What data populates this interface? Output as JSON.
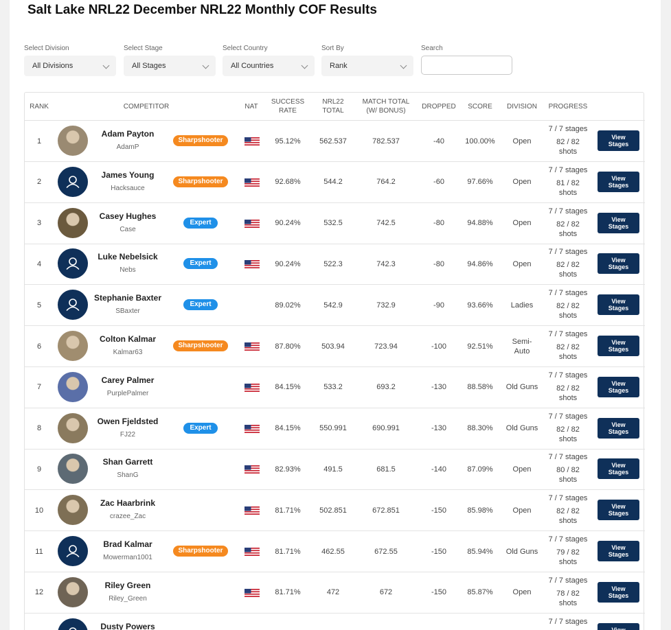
{
  "page_title": "Salt Lake NRL22 December NRL22 Monthly COF Results",
  "filters": {
    "division": {
      "label": "Select Division",
      "value": "All Divisions"
    },
    "stage": {
      "label": "Select Stage",
      "value": "All Stages"
    },
    "country": {
      "label": "Select Country",
      "value": "All Countries"
    },
    "sort": {
      "label": "Sort By",
      "value": "Rank"
    },
    "search": {
      "label": "Search",
      "placeholder": ""
    }
  },
  "columns": {
    "rank": "RANK",
    "competitor": "COMPETITOR",
    "nat": "NAT",
    "success_rate_1": "SUCCESS",
    "success_rate_2": "RATE",
    "nrl22_total_1": "NRL22",
    "nrl22_total_2": "TOTAL",
    "match_total_1": "MATCH TOTAL",
    "match_total_2": "(W/ BONUS)",
    "dropped": "DROPPED",
    "score": "SCORE",
    "division": "DIVISION",
    "progress": "PROGRESS"
  },
  "view_button_label": "View Stages",
  "rows": [
    {
      "rank": "1",
      "name": "Adam Payton",
      "user": "AdamP",
      "badge": "Sharpshooter",
      "badge_type": "sharp",
      "flag": true,
      "success": "95.12%",
      "nrl22": "562.537",
      "match": "782.537",
      "dropped": "-40",
      "score": "100.00%",
      "division": "Open",
      "stages": "7 / 7 stages",
      "shots": "82 / 82 shots",
      "avatar": "photo",
      "avatar_color": "#9a8a72"
    },
    {
      "rank": "2",
      "name": "James Young",
      "user": "Hacksauce",
      "badge": "Sharpshooter",
      "badge_type": "sharp",
      "flag": true,
      "success": "92.68%",
      "nrl22": "544.2",
      "match": "764.2",
      "dropped": "-60",
      "score": "97.66%",
      "division": "Open",
      "stages": "7 / 7 stages",
      "shots": "81 / 82 shots",
      "avatar": "default",
      "avatar_color": "#0f3059"
    },
    {
      "rank": "3",
      "name": "Casey Hughes",
      "user": "Case",
      "badge": "Expert",
      "badge_type": "expert",
      "flag": true,
      "success": "90.24%",
      "nrl22": "532.5",
      "match": "742.5",
      "dropped": "-80",
      "score": "94.88%",
      "division": "Open",
      "stages": "7 / 7 stages",
      "shots": "82 / 82 shots",
      "avatar": "photo",
      "avatar_color": "#6b5a3e"
    },
    {
      "rank": "4",
      "name": "Luke Nebelsick",
      "user": "Nebs",
      "badge": "Expert",
      "badge_type": "expert",
      "flag": true,
      "success": "90.24%",
      "nrl22": "522.3",
      "match": "742.3",
      "dropped": "-80",
      "score": "94.86%",
      "division": "Open",
      "stages": "7 / 7 stages",
      "shots": "82 / 82 shots",
      "avatar": "default",
      "avatar_color": "#0f3059"
    },
    {
      "rank": "5",
      "name": "Stephanie Baxter",
      "user": "SBaxter",
      "badge": "Expert",
      "badge_type": "expert",
      "flag": false,
      "success": "89.02%",
      "nrl22": "542.9",
      "match": "732.9",
      "dropped": "-90",
      "score": "93.66%",
      "division": "Ladies",
      "stages": "7 / 7 stages",
      "shots": "82 / 82 shots",
      "avatar": "default",
      "avatar_color": "#0f3059"
    },
    {
      "rank": "6",
      "name": "Colton Kalmar",
      "user": "Kalmar63",
      "badge": "Sharpshooter",
      "badge_type": "sharp",
      "flag": true,
      "success": "87.80%",
      "nrl22": "503.94",
      "match": "723.94",
      "dropped": "-100",
      "score": "92.51%",
      "division": "Semi-Auto",
      "stages": "7 / 7 stages",
      "shots": "82 / 82 shots",
      "avatar": "photo",
      "avatar_color": "#a08d6f"
    },
    {
      "rank": "7",
      "name": "Carey Palmer",
      "user": "PurplePalmer",
      "badge": "",
      "badge_type": "none",
      "flag": true,
      "success": "84.15%",
      "nrl22": "533.2",
      "match": "693.2",
      "dropped": "-130",
      "score": "88.58%",
      "division": "Old Guns",
      "stages": "7 / 7 stages",
      "shots": "82 / 82 shots",
      "avatar": "photo",
      "avatar_color": "#5a6fa8"
    },
    {
      "rank": "8",
      "name": "Owen Fjeldsted",
      "user": "FJ22",
      "badge": "Expert",
      "badge_type": "expert",
      "flag": true,
      "success": "84.15%",
      "nrl22": "550.991",
      "match": "690.991",
      "dropped": "-130",
      "score": "88.30%",
      "division": "Old Guns",
      "stages": "7 / 7 stages",
      "shots": "82 / 82 shots",
      "avatar": "photo",
      "avatar_color": "#8a7a5e"
    },
    {
      "rank": "9",
      "name": "Shan Garrett",
      "user": "ShanG",
      "badge": "",
      "badge_type": "none",
      "flag": true,
      "success": "82.93%",
      "nrl22": "491.5",
      "match": "681.5",
      "dropped": "-140",
      "score": "87.09%",
      "division": "Open",
      "stages": "7 / 7 stages",
      "shots": "80 / 82 shots",
      "avatar": "photo",
      "avatar_color": "#5d6a74"
    },
    {
      "rank": "10",
      "name": "Zac Haarbrink",
      "user": "crazee_Zac",
      "badge": "",
      "badge_type": "none",
      "flag": true,
      "success": "81.71%",
      "nrl22": "502.851",
      "match": "672.851",
      "dropped": "-150",
      "score": "85.98%",
      "division": "Open",
      "stages": "7 / 7 stages",
      "shots": "82 / 82 shots",
      "avatar": "photo",
      "avatar_color": "#7e6f55"
    },
    {
      "rank": "11",
      "name": "Brad Kalmar",
      "user": "Mowerman1001",
      "badge": "Sharpshooter",
      "badge_type": "sharp",
      "flag": true,
      "success": "81.71%",
      "nrl22": "462.55",
      "match": "672.55",
      "dropped": "-150",
      "score": "85.94%",
      "division": "Old Guns",
      "stages": "7 / 7 stages",
      "shots": "79 / 82 shots",
      "avatar": "default",
      "avatar_color": "#0f3059"
    },
    {
      "rank": "12",
      "name": "Riley Green",
      "user": "Riley_Green",
      "badge": "",
      "badge_type": "none",
      "flag": true,
      "success": "81.71%",
      "nrl22": "472",
      "match": "672",
      "dropped": "-150",
      "score": "85.87%",
      "division": "Open",
      "stages": "7 / 7 stages",
      "shots": "78 / 82 shots",
      "avatar": "photo",
      "avatar_color": "#6f6455"
    },
    {
      "rank": "",
      "name": "Dusty Powers",
      "user": "",
      "badge": "",
      "badge_type": "none",
      "flag": false,
      "success": "",
      "nrl22": "",
      "match": "",
      "dropped": "",
      "score": "",
      "division": "",
      "stages": "7 / 7 stages",
      "shots": "",
      "avatar": "default",
      "avatar_color": "#0f3059"
    }
  ]
}
